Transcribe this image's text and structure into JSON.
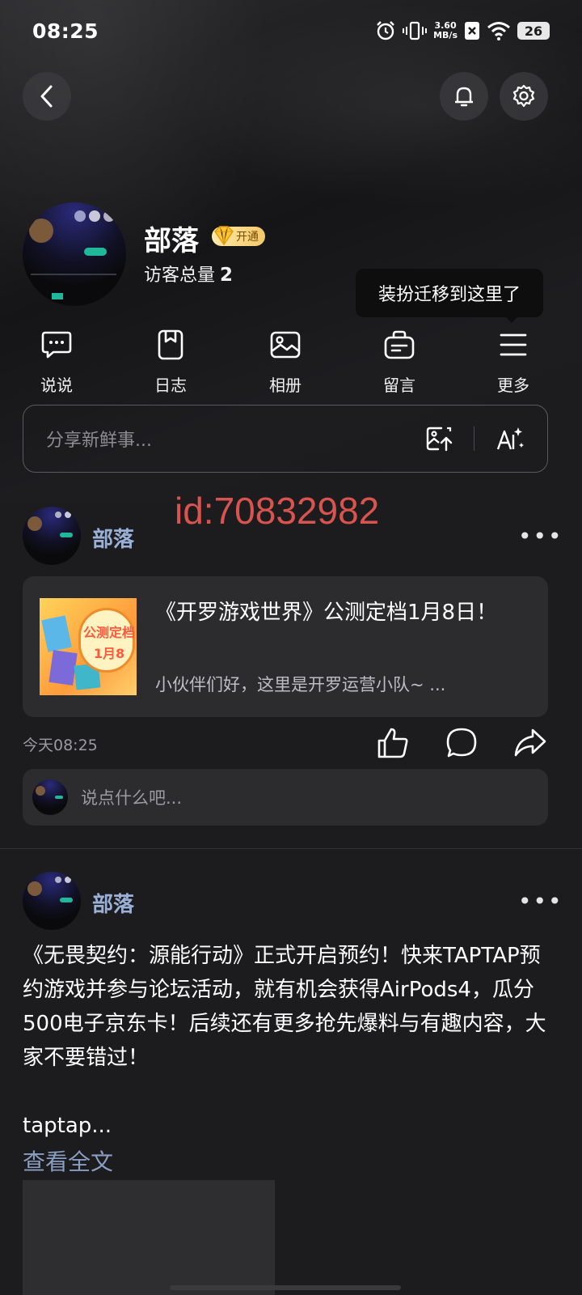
{
  "status_bar": {
    "time": "08:25",
    "speed_value": "3.60",
    "speed_unit": "MB/s",
    "battery": "26",
    "icons": [
      "alarm-icon",
      "vibrate-icon",
      "sim-x-icon",
      "wifi-icon",
      "battery-icon"
    ]
  },
  "header": {
    "back_icon": "chevron-left-icon",
    "bell_icon": "bell-icon",
    "settings_icon": "gear-icon"
  },
  "profile": {
    "name": "部落",
    "vip_label": "开通",
    "visitor_label": "访客总量",
    "visitor_count": "2"
  },
  "tooltip": {
    "text": "装扮迁移到这里了"
  },
  "quick_actions": [
    {
      "label": "说说",
      "icon": "chat-bubble-icon"
    },
    {
      "label": "日志",
      "icon": "journal-icon"
    },
    {
      "label": "相册",
      "icon": "photo-icon"
    },
    {
      "label": "留言",
      "icon": "message-bag-icon"
    },
    {
      "label": "更多",
      "icon": "menu-icon"
    }
  ],
  "composer": {
    "placeholder": "分享新鲜事...",
    "icons": [
      "image-upload-icon",
      "ai-magic-icon"
    ]
  },
  "watermark": "id:70832982",
  "posts": [
    {
      "author": "部落",
      "more": "•••",
      "card": {
        "title": "《开罗游戏世界》公测定档1月8日！",
        "subtitle": "小伙伴们好，这里是开罗运营小队~ ...",
        "thumb_text": "公测定档 1月8"
      },
      "time": "今天08:25",
      "actions": [
        "like-icon",
        "comment-icon",
        "share-icon"
      ],
      "comment_placeholder": "说点什么吧..."
    },
    {
      "author": "部落",
      "more": "•••",
      "text": "《无畏契约：源能行动》正式开启预约！快来TAPTAP预约游戏并参与论坛活动，就有机会获得AirPods4，瓜分500电子京东卡！后续还有更多抢先爆料与有趣内容，大家不要错过！",
      "text_tail": "taptap...",
      "see_full": "查看全文"
    }
  ],
  "colors": {
    "background": "#1c1c1e",
    "card": "#2c2c2f",
    "author_name": "#9bb0d6",
    "watermark": "#d9534f",
    "vip_gold": "#f3c86a"
  }
}
